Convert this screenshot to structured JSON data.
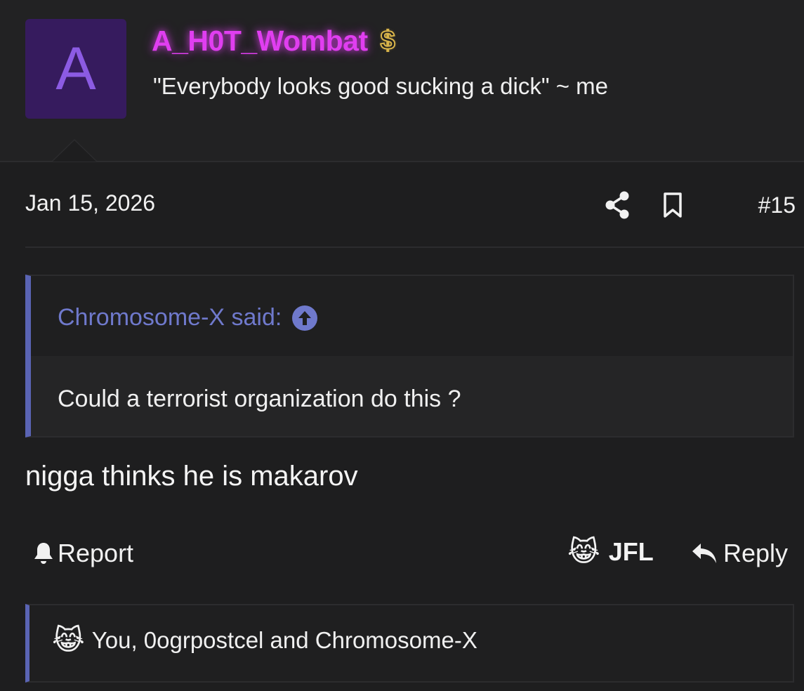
{
  "user": {
    "avatar_letter": "A",
    "username": "A_H0T_Wombat",
    "username_color": "#e03ef0",
    "badge_icon": "dollar-icon",
    "badge_symbol": "$",
    "title": "\"Everybody looks good sucking a dick\" ~ me"
  },
  "meta": {
    "date": "Jan 15, 2026",
    "share_icon": "share-icon",
    "bookmark_icon": "bookmark-icon",
    "post_number": "#15"
  },
  "quote": {
    "author_label": "Chromosome-X said:",
    "jump_icon": "arrow-up-circle-icon",
    "text": "Could a terrorist organization do this ?",
    "accent_color": "#5a64b4"
  },
  "post": {
    "body": "nigga thinks he is makarov"
  },
  "actions": {
    "report_label": "Report",
    "jfl_emoji": "😹",
    "jfl_label": "JFL",
    "reply_label": "Reply"
  },
  "reactions": {
    "emoji": "😹",
    "text": "You, 0ogrpostcel and Chromosome-X"
  }
}
